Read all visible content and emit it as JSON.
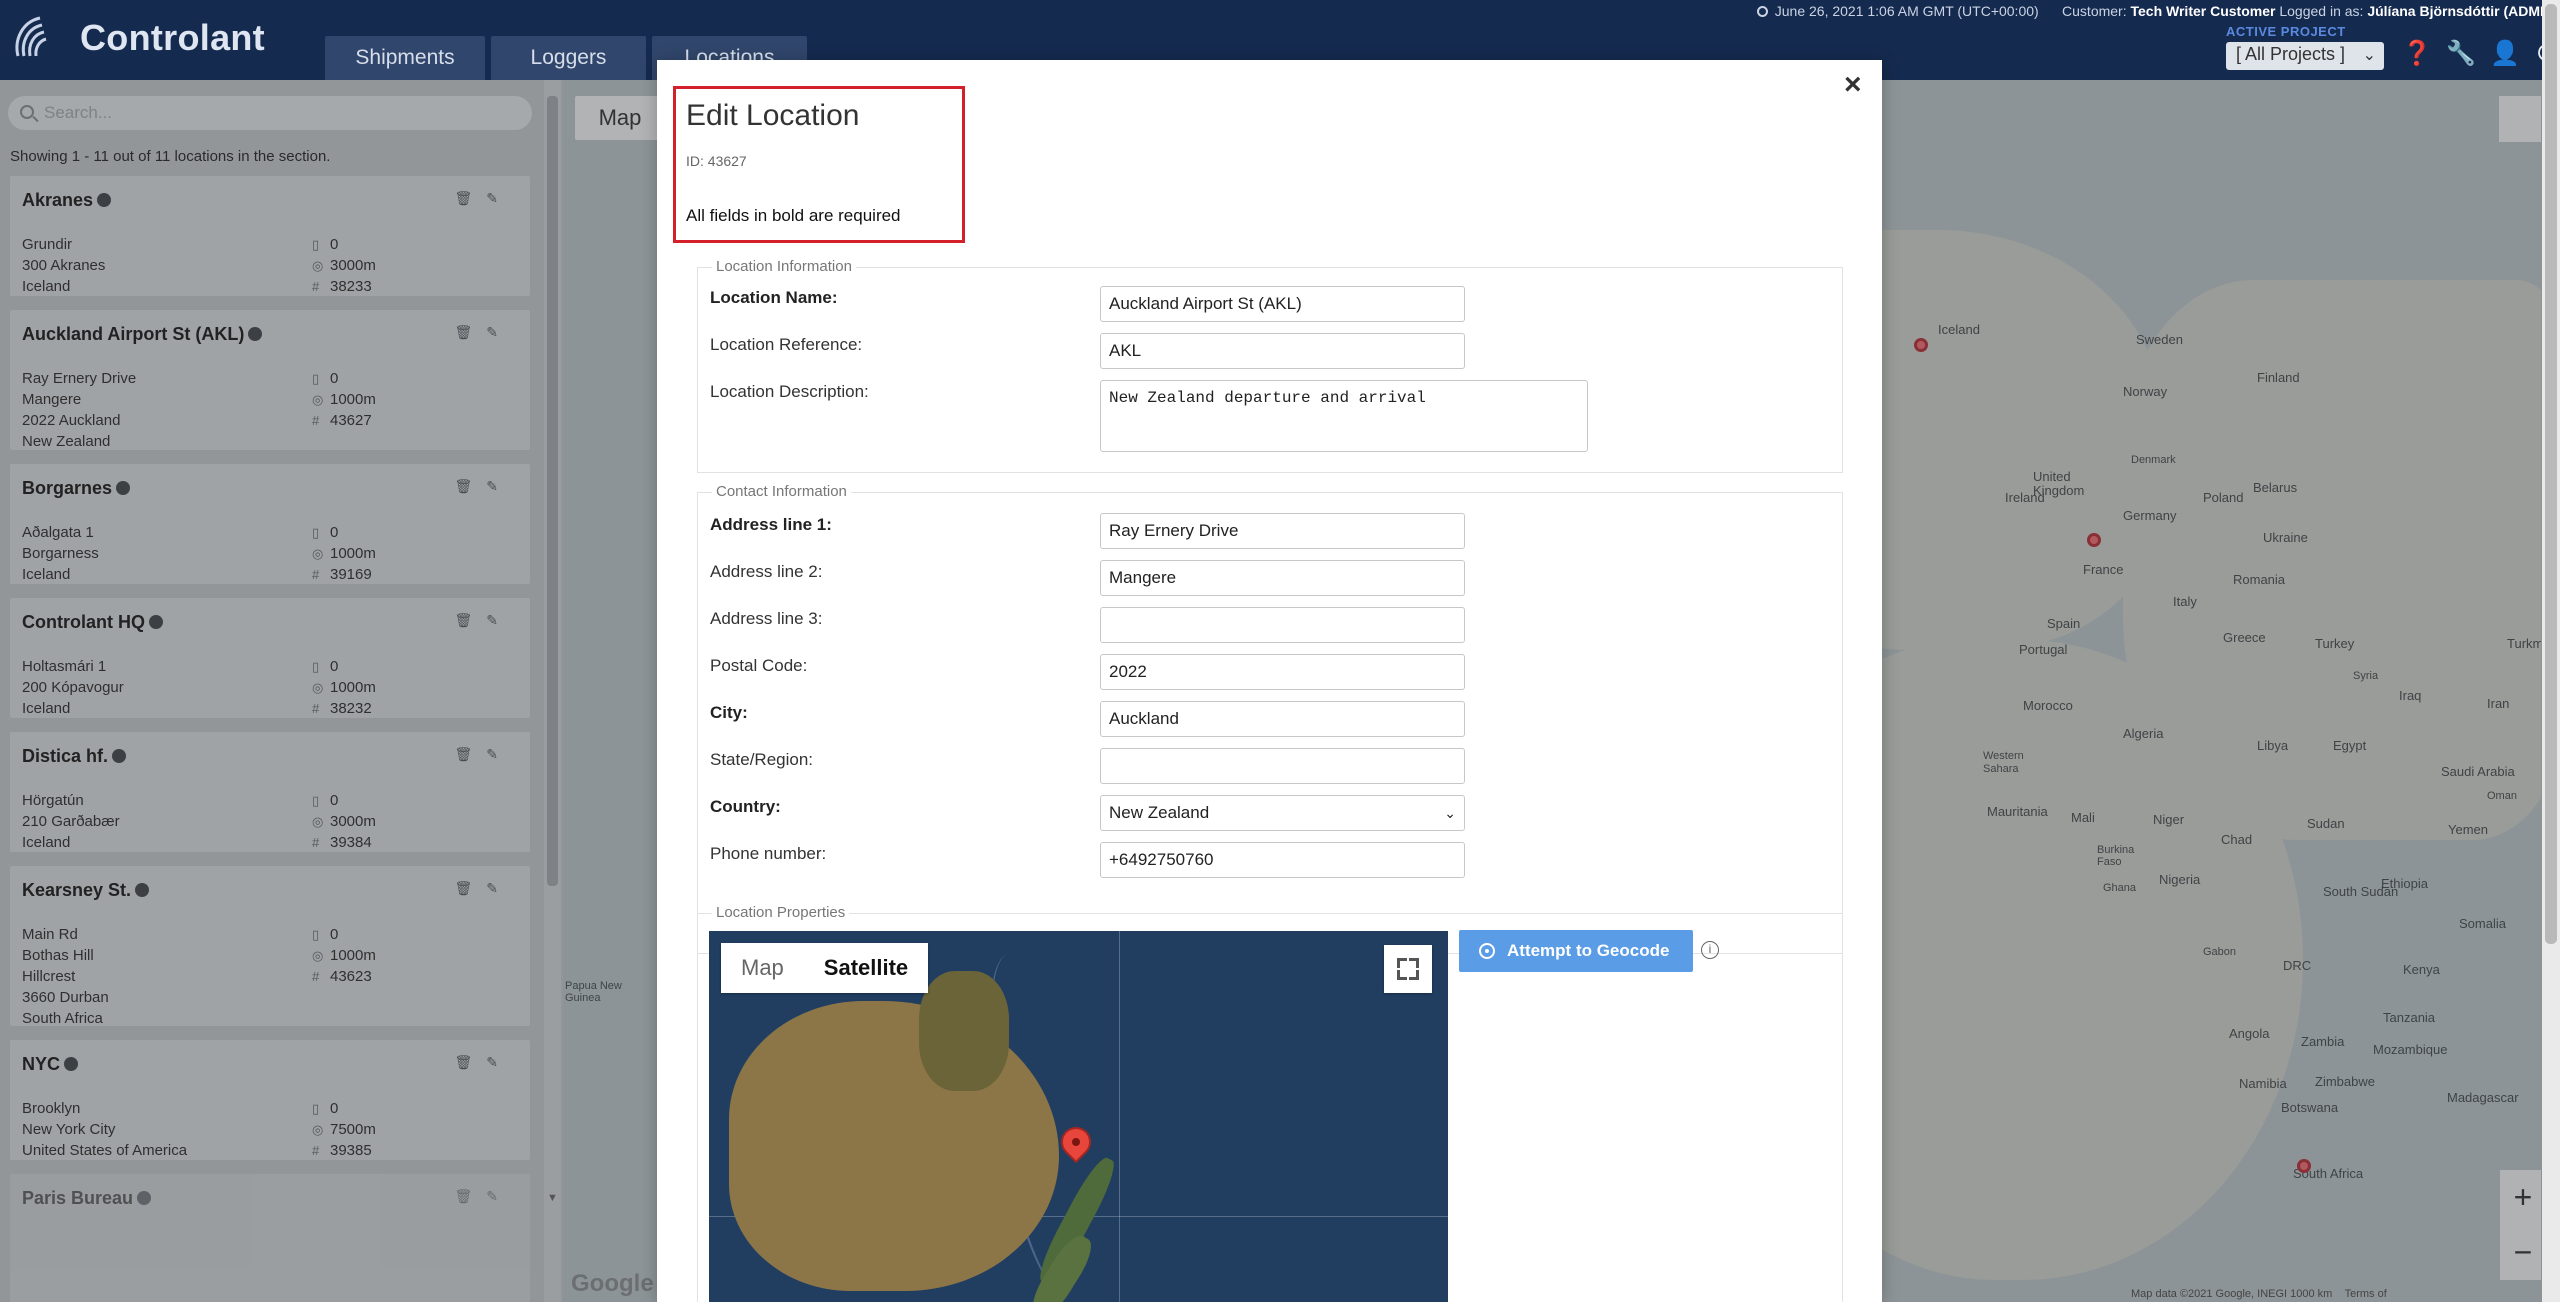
{
  "app": {
    "brand": "Controlant",
    "tabs": [
      "Shipments",
      "Loggers",
      "Locations"
    ]
  },
  "topinfo": {
    "datetime": "June 26, 2021 1:06 AM GMT (UTC+00:00)",
    "customer_label": "Customer:",
    "customer": "Tech Writer Customer",
    "logged_label": "Logged in as:",
    "user": "Júlíana Björnsdóttir (ADMIN"
  },
  "project": {
    "label": "ACTIVE PROJECT",
    "selected": "[ All Projects ]"
  },
  "sidebar": {
    "search_placeholder": "Search...",
    "count_text": "Showing 1 - 11 out of 11 locations in the section.",
    "locations": [
      {
        "name": "Akranes",
        "address": [
          "Grundir",
          "300 Akranes",
          "Iceland"
        ],
        "loggers": "0",
        "radius": "3000m",
        "id": "38233"
      },
      {
        "name": "Auckland Airport St (AKL)",
        "address": [
          "Ray Ernery Drive",
          "Mangere",
          "2022 Auckland",
          "New Zealand"
        ],
        "loggers": "0",
        "radius": "1000m",
        "id": "43627"
      },
      {
        "name": "Borgarnes",
        "address": [
          "Aðalgata 1",
          "Borgarness",
          "Iceland"
        ],
        "loggers": "0",
        "radius": "1000m",
        "id": "39169"
      },
      {
        "name": "Controlant HQ",
        "address": [
          "Holtasmári 1",
          "200 Kópavogur",
          "Iceland"
        ],
        "loggers": "0",
        "radius": "1000m",
        "id": "38232"
      },
      {
        "name": "Distica hf.",
        "address": [
          "Hörgatún",
          "210 Garðabær",
          "Iceland"
        ],
        "loggers": "0",
        "radius": "3000m",
        "id": "39384"
      },
      {
        "name": "Kearsney St.",
        "address": [
          "Main Rd",
          "Bothas Hill",
          "Hillcrest",
          "3660 Durban",
          "South Africa"
        ],
        "loggers": "0",
        "radius": "1000m",
        "id": "43623"
      },
      {
        "name": "NYC",
        "address": [
          "Brooklyn",
          "New York City",
          "United States of America"
        ],
        "loggers": "0",
        "radius": "7500m",
        "id": "39385"
      },
      {
        "name": "Paris Bureau",
        "address": [],
        "loggers": "",
        "radius": "",
        "id": ""
      }
    ]
  },
  "bgmap": {
    "map_button": "Map",
    "labels": [
      "Iceland",
      "Sweden",
      "Finland",
      "Norway",
      "Denmark",
      "United Kingdom",
      "Ireland",
      "Belarus",
      "Poland",
      "Germany",
      "Ukraine",
      "France",
      "Romania",
      "Italy",
      "Spain",
      "Portugal",
      "Greece",
      "Turkey",
      "Turkmenista",
      "Syria",
      "Iraq",
      "Iran",
      "Morocco",
      "Algeria",
      "Libya",
      "Egypt",
      "Saudi Arabia",
      "Western Sahara",
      "Mauritania",
      "Mali",
      "Niger",
      "Chad",
      "Sudan",
      "Yemen",
      "Oman",
      "Burkina Faso",
      "Ghana",
      "Nigeria",
      "South Sudan",
      "Ethiopia",
      "Somalia",
      "Gabon",
      "DRC",
      "Kenya",
      "Tanzania",
      "Angola",
      "Zambia",
      "Mozambique",
      "Namibia",
      "Zimbabwe",
      "Botswana",
      "Madagascar",
      "South Africa",
      "Papua New Guinea"
    ],
    "footer": "Map data ©2021 Google, INEGI   1000 km",
    "terms": "Terms of",
    "zoom_in": "+",
    "zoom_out": "−",
    "google": "Google"
  },
  "modal": {
    "title": "Edit Location",
    "id_text": "ID: 43627",
    "required_note": "All fields in bold are required",
    "close": "×",
    "sections": {
      "location_info": "Location Information",
      "contact_info": "Contact Information",
      "properties": "Location Properties"
    },
    "fields": {
      "location_name": {
        "label": "Location Name:",
        "value": "Auckland Airport St (AKL)"
      },
      "location_reference": {
        "label": "Location Reference:",
        "value": "AKL"
      },
      "location_description": {
        "label": "Location Description:",
        "value": "New Zealand departure and arrival"
      },
      "address1": {
        "label": "Address line 1:",
        "value": "Ray Ernery Drive"
      },
      "address2": {
        "label": "Address line 2:",
        "value": "Mangere"
      },
      "address3": {
        "label": "Address line 3:",
        "value": ""
      },
      "postal": {
        "label": "Postal Code:",
        "value": "2022"
      },
      "city": {
        "label": "City:",
        "value": "Auckland"
      },
      "state": {
        "label": "State/Region:",
        "value": ""
      },
      "country": {
        "label": "Country:",
        "value": "New Zealand"
      },
      "phone": {
        "label": "Phone number:",
        "value": "+6492750760"
      }
    },
    "embed_map": {
      "tab_map": "Map",
      "tab_satellite": "Satellite"
    },
    "geocode_button": "Attempt to Geocode",
    "info": "i"
  },
  "colors": {
    "nav_bg": "#152a4f",
    "accent": "#5b9ce6",
    "highlight_border": "#d4202a"
  }
}
